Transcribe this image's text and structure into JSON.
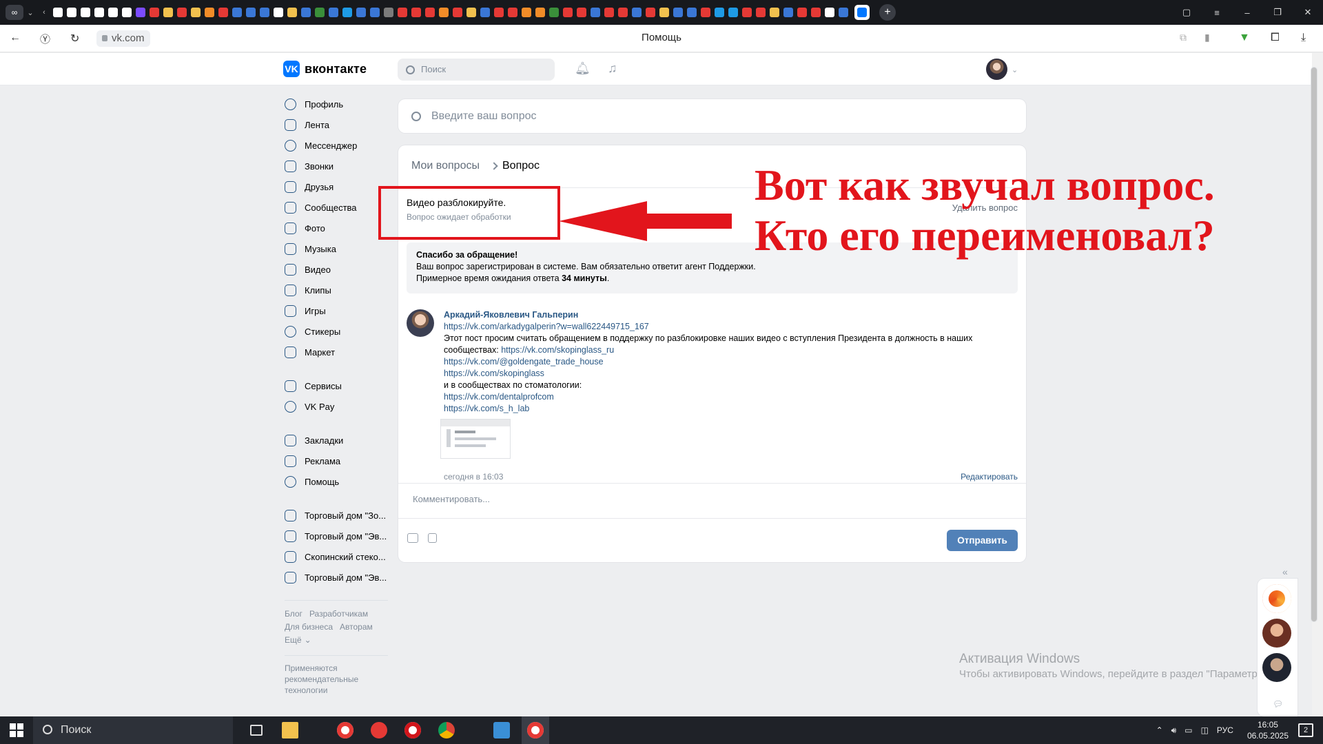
{
  "browser": {
    "address": "vk.com",
    "page_title": "Помощь"
  },
  "vk": {
    "logo_text": "вконтакте",
    "search_placeholder": "Поиск"
  },
  "sidebar": {
    "items": [
      {
        "label": "Профиль",
        "icon": "profile-icon"
      },
      {
        "label": "Лента",
        "icon": "feed-icon"
      },
      {
        "label": "Мессенджер",
        "icon": "messenger-icon"
      },
      {
        "label": "Звонки",
        "icon": "phone-icon"
      },
      {
        "label": "Друзья",
        "icon": "friends-icon"
      },
      {
        "label": "Сообщества",
        "icon": "communities-icon"
      },
      {
        "label": "Фото",
        "icon": "photo-icon"
      },
      {
        "label": "Музыка",
        "icon": "music-icon"
      },
      {
        "label": "Видео",
        "icon": "video-icon"
      },
      {
        "label": "Клипы",
        "icon": "clips-icon"
      },
      {
        "label": "Игры",
        "icon": "games-icon"
      },
      {
        "label": "Стикеры",
        "icon": "stickers-icon"
      },
      {
        "label": "Маркет",
        "icon": "market-icon"
      }
    ],
    "items2": [
      {
        "label": "Сервисы",
        "icon": "services-icon"
      },
      {
        "label": "VK Pay",
        "icon": "vkpay-icon"
      }
    ],
    "items3": [
      {
        "label": "Закладки",
        "icon": "bookmarks-icon"
      },
      {
        "label": "Реклама",
        "icon": "ads-icon"
      },
      {
        "label": "Помощь",
        "icon": "help-icon"
      }
    ],
    "groups": [
      {
        "label": "Торговый дом \"Зо..."
      },
      {
        "label": "Торговый дом \"Эв..."
      },
      {
        "label": "Скопинский стеко..."
      },
      {
        "label": "Торговый дом \"Эв..."
      }
    ],
    "footer": {
      "blog": "Блог",
      "developers": "Разработчикам",
      "business": "Для бизнеса",
      "authors": "Авторам",
      "more": "Ещё",
      "recommend": "Применяются рекомендательные технологии"
    }
  },
  "help": {
    "search_placeholder": "Введите ваш вопрос",
    "breadcrumb": {
      "parent": "Мои вопросы",
      "current": "Вопрос"
    },
    "question_title": "Видео разблокируйте.",
    "question_status": "Вопрос ожидает обработки",
    "delete_label": "Удалить вопрос",
    "notice": {
      "title": "Спасибо за обращение!",
      "line1": "Ваш вопрос зарегистрирован в системе. Вам обязательно ответит агент Поддержки.",
      "line2_prefix": "Примерное время ожидания ответа ",
      "line2_bold": "34 минуты",
      "line2_suffix": "."
    },
    "post": {
      "author": "Аркадий-Яковлевич Гальперин",
      "link1": "https://vk.com/arkadygalperin?w=wall622449715_167",
      "text1": "Этот пост просим считать обращением в поддержку по разблокировке наших видео с вступления Президента в должность в наших сообществах: ",
      "link2": "https://vk.com/skopinglass_ru",
      "link3": "https://vk.com/@goldengate_trade_house",
      "link4": "https://vk.com/skopinglass",
      "text2": "и в сообществах по стоматологии:",
      "link5": "https://vk.com/dentalprofcom",
      "link6": "https://vk.com/s_h_lab",
      "time": "сегодня в 16:03",
      "edit_label": "Редактировать"
    },
    "comment_placeholder": "Комментировать...",
    "send_label": "Отправить"
  },
  "annotation": {
    "line1": "Вот как звучал вопрос.",
    "line2": "Кто его переименовал?",
    "color": "#e2151c"
  },
  "watermark": {
    "line1": "Активация Windows",
    "line2": "Чтобы активировать Windows, перейдите в раздел \"Параметры\""
  },
  "taskbar": {
    "search_label": "Поиск",
    "lang": "РУС",
    "time": "16:05",
    "date": "06.05.2025",
    "notifications": "2"
  },
  "colors": {
    "vk_blue": "#0077ff",
    "link": "#2a5885",
    "button": "#5181b8"
  }
}
